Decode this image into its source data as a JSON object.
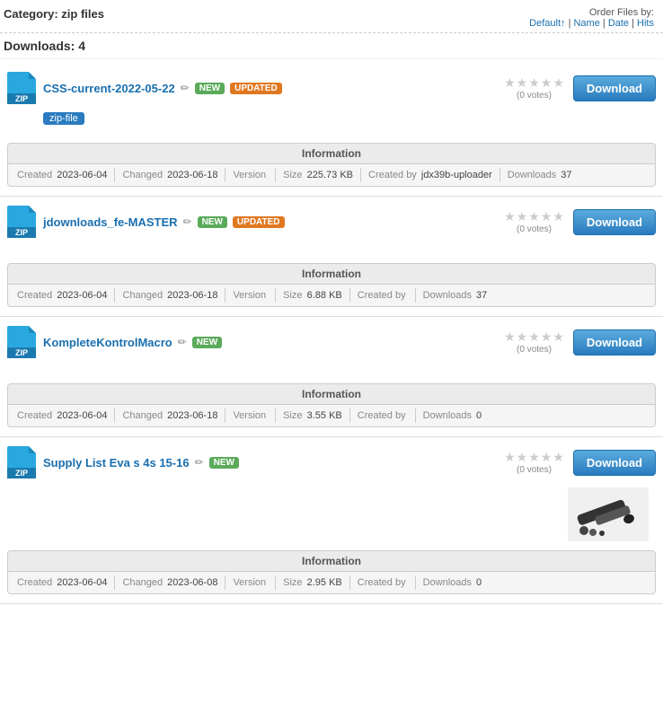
{
  "page": {
    "category_label": "Category: zip files",
    "order_label": "Order Files by:",
    "order_links": [
      "Default↑",
      "Name",
      "Date",
      "Hits"
    ],
    "downloads_count_label": "Downloads: 4"
  },
  "files": [
    {
      "id": 1,
      "name": "CSS-current-2022-05-22",
      "has_edit": true,
      "badges": [
        "NEW",
        "UPDATED"
      ],
      "stars": 0,
      "votes": "(0 votes)",
      "download_label": "Download",
      "tag": "zip-file",
      "info": {
        "header": "Information",
        "created_label": "Created",
        "created": "2023-06-04",
        "changed_label": "Changed",
        "changed": "2023-06-18",
        "version_label": "Version",
        "version": "",
        "size_label": "Size",
        "size": "225.73 KB",
        "created_by_label": "Created by",
        "created_by": "jdx39b-uploader",
        "downloads_label": "Downloads",
        "downloads": "37"
      },
      "has_thumbnail": false
    },
    {
      "id": 2,
      "name": "jdownloads_fe-MASTER",
      "has_edit": true,
      "badges": [
        "NEW",
        "UPDATED"
      ],
      "stars": 0,
      "votes": "(0 votes)",
      "download_label": "Download",
      "tag": null,
      "info": {
        "header": "Information",
        "created_label": "Created",
        "created": "2023-06-04",
        "changed_label": "Changed",
        "changed": "2023-06-18",
        "version_label": "Version",
        "version": "",
        "size_label": "Size",
        "size": "6.88 KB",
        "created_by_label": "Created by",
        "created_by": "",
        "downloads_label": "Downloads",
        "downloads": "37"
      },
      "has_thumbnail": false
    },
    {
      "id": 3,
      "name": "KompleteKontrolMacro",
      "has_edit": true,
      "badges": [
        "NEW"
      ],
      "stars": 0,
      "votes": "(0 votes)",
      "download_label": "Download",
      "tag": null,
      "info": {
        "header": "Information",
        "created_label": "Created",
        "created": "2023-06-04",
        "changed_label": "Changed",
        "changed": "2023-06-18",
        "version_label": "Version",
        "version": "",
        "size_label": "Size",
        "size": "3.55 KB",
        "created_by_label": "Created by",
        "created_by": "",
        "downloads_label": "Downloads",
        "downloads": "0"
      },
      "has_thumbnail": false
    },
    {
      "id": 4,
      "name": "Supply List Eva s 4s 15-16",
      "has_edit": true,
      "badges": [
        "NEW"
      ],
      "stars": 0,
      "votes": "(0 votes)",
      "download_label": "Download",
      "tag": null,
      "info": {
        "header": "Information",
        "created_label": "Created",
        "created": "2023-06-04",
        "changed_label": "Changed",
        "changed": "2023-06-08",
        "version_label": "Version",
        "version": "",
        "size_label": "Size",
        "size": "2.95 KB",
        "created_by_label": "Created by",
        "created_by": "",
        "downloads_label": "Downloads",
        "downloads": "0"
      },
      "has_thumbnail": true
    }
  ]
}
